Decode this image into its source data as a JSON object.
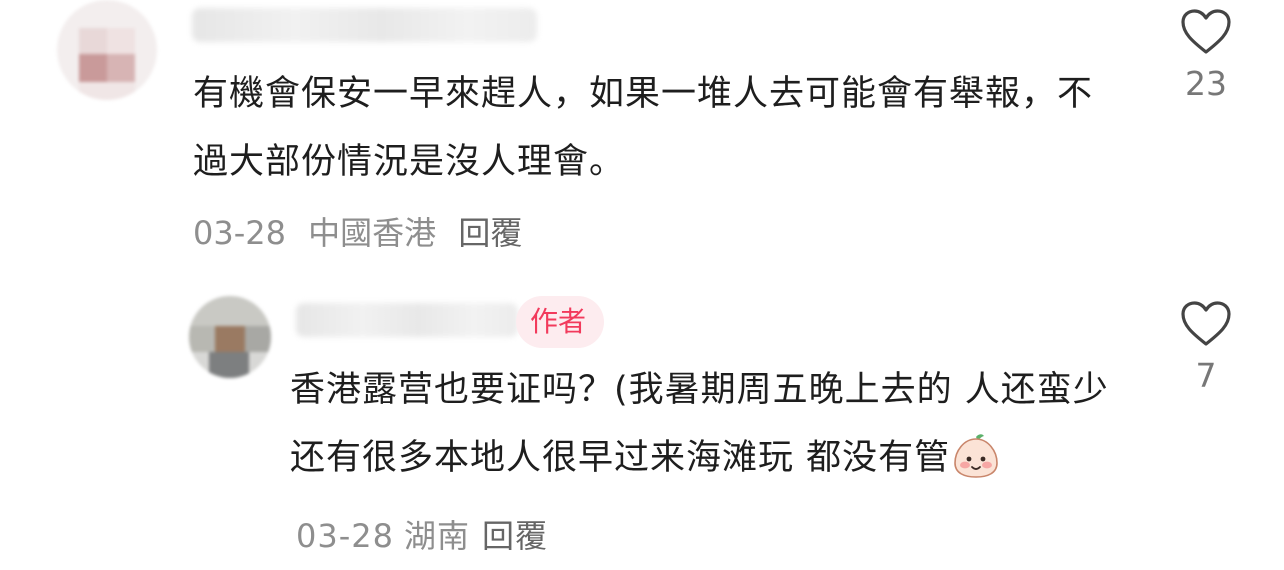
{
  "comments": [
    {
      "text": "有機會保安一早來趕人，如果一堆人去可能會有舉報，不過大部份情況是沒人理會。",
      "date": "03-28",
      "location": "中國香港",
      "reply_label": "回覆",
      "like_count": "23",
      "avatar_icon": "blurred-avatar"
    },
    {
      "author_badge": "作者",
      "text": "香港露营也要证吗？(我暑期周五晚上去的 人还蛮少 还有很多本地人很早过来海滩玩 都没有管",
      "emoji_icon": "smiling-face-sticker",
      "date": "03-28",
      "location": "湖南",
      "reply_label": "回覆",
      "like_count": "7",
      "avatar_icon": "blurred-avatar"
    }
  ],
  "colors": {
    "text": "#1e1e1e",
    "meta": "#8e8e8e",
    "badge_bg": "#fdecef",
    "badge_text": "#f23a5c",
    "heart_stroke": "#444444"
  }
}
